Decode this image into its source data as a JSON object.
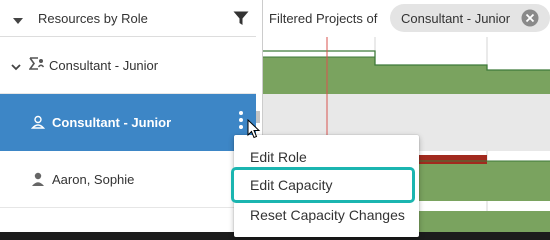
{
  "left_panel": {
    "header_title": "Resources by Role",
    "rows": [
      {
        "label": "Consultant - Junior"
      },
      {
        "label": "Consultant - Junior"
      },
      {
        "label": "Aaron, Sophie"
      }
    ]
  },
  "right_panel": {
    "filter_label": "Filtered Projects of",
    "filter_chip": "Consultant - Junior"
  },
  "context_menu": {
    "items": [
      "Edit Role",
      "Edit Capacity",
      "Reset Capacity Changes"
    ],
    "highlighted_item": "Edit Capacity"
  },
  "colors": {
    "selected_row": "#3d86c6",
    "capacity_bar": "#7aa35f",
    "capacity_outline": "#3f7a3a",
    "over_allocation": "#a22a1e",
    "today_line": "#d9534f",
    "highlight_outline": "#1bb5b0"
  },
  "icons": [
    "caret-down-icon",
    "filter-icon",
    "chevron-down-icon",
    "sigma-icon",
    "role-icon",
    "kebab-icon",
    "person-icon",
    "close-icon",
    "cursor-icon"
  ]
}
